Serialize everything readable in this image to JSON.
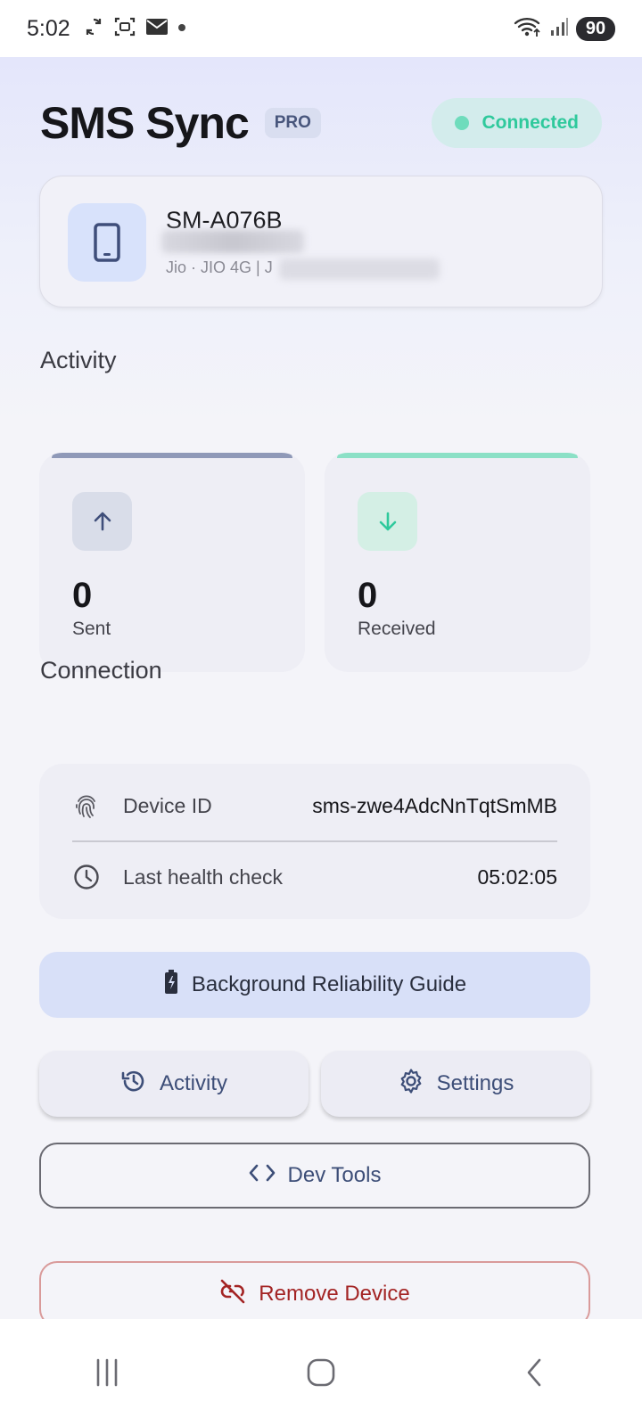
{
  "status_bar": {
    "time": "5:02",
    "battery": "90",
    "icons": [
      "sync-icon",
      "screenshot-icon",
      "mail-icon",
      "dot-icon",
      "wifi-icon",
      "signal-icon"
    ]
  },
  "header": {
    "title": "SMS Sync",
    "badge": "PRO",
    "status": "Connected",
    "status_color": "#2fc99c"
  },
  "device": {
    "model": "SM-A076B",
    "carrier": "Jio · JIO 4G | J",
    "icon": "smartphone-icon"
  },
  "activity": {
    "title": "Activity",
    "sent": {
      "value": "0",
      "label": "Sent",
      "accent": "#8f99b8"
    },
    "received": {
      "value": "0",
      "label": "Received",
      "accent": "#8be0c6"
    }
  },
  "connection": {
    "title": "Connection",
    "device_id": {
      "label": "Device ID",
      "value": "sms-zwe4AdcNnTqtSmMB"
    },
    "health_check": {
      "label": "Last health check",
      "value": "05:02:05"
    }
  },
  "buttons": {
    "guide": "Background Reliability Guide",
    "activity": "Activity",
    "settings": "Settings",
    "dev_tools": "Dev Tools",
    "remove": "Remove Device"
  }
}
